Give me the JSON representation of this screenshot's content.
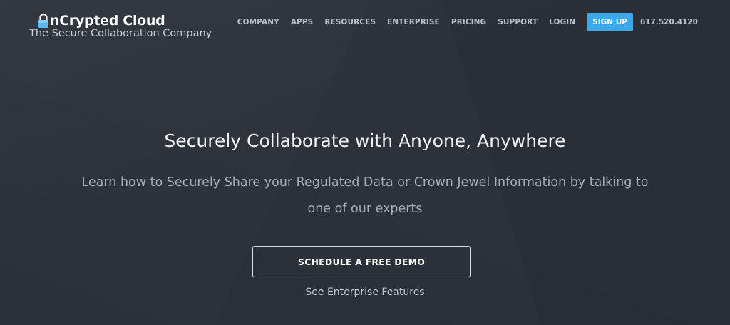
{
  "header": {
    "logo_text": "nCrypted Cloud",
    "logo_icon": "padlock-icon",
    "tagline": "The Secure Collaboration Company"
  },
  "nav": {
    "items": [
      "COMPANY",
      "APPS",
      "RESOURCES",
      "ENTERPRISE",
      "PRICING",
      "SUPPORT",
      "LOGIN"
    ],
    "signup_label": "SIGN UP",
    "phone": "617.520.4120"
  },
  "hero": {
    "title": "Securely Collaborate with Anyone, Anywhere",
    "subtitle": "Learn how to Securely Share your Regulated Data or Crown Jewel Information by talking to one of our experts",
    "cta_label": "SCHEDULE A FREE DEMO",
    "secondary_link": "See Enterprise Features"
  },
  "colors": {
    "background": "#2c313a",
    "accent": "#3aa8ea",
    "nav_text": "#b9c0ca",
    "subtitle_text": "#a7aeb8"
  }
}
